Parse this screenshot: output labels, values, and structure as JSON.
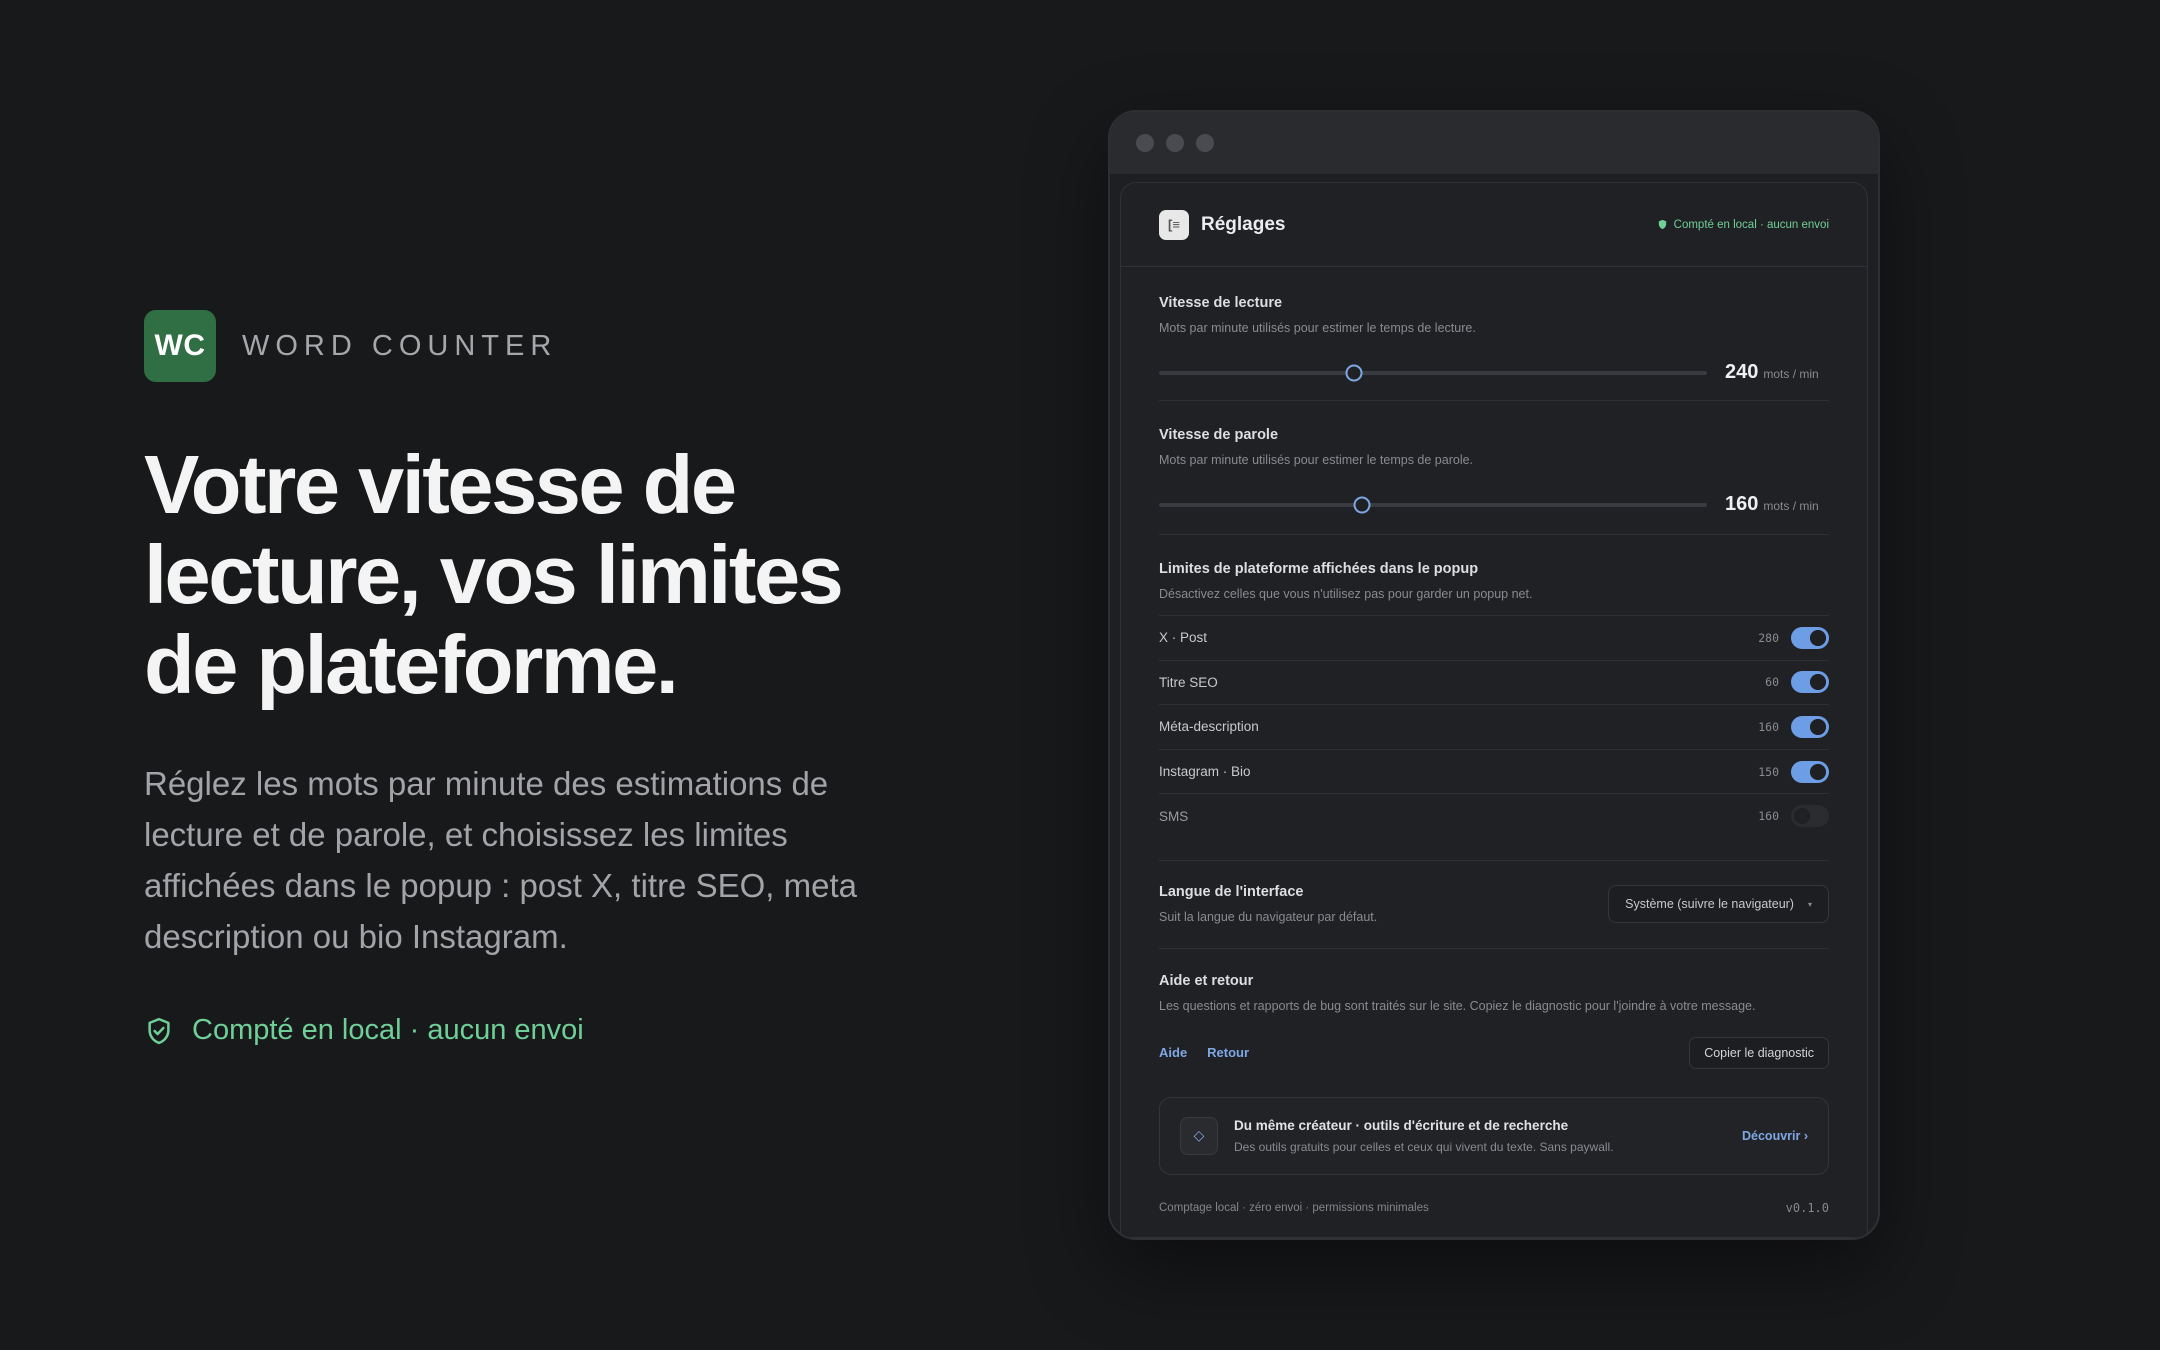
{
  "brand": {
    "logo_text": "WC",
    "name": "WORD COUNTER"
  },
  "hero": {
    "title_lines": [
      "Votre vitesse de",
      "lecture, vos limites",
      "de plateforme."
    ],
    "subtitle": "Réglez les mots par minute des estimations de lecture et de parole, et choisissez les limites affichées dans le popup : post X, titre SEO, meta description ou bio Instagram.",
    "badge": "Compté en local · aucun envoi"
  },
  "colors": {
    "accent": "#6d9de4",
    "brand": "#2f6f43",
    "success": "#6fcf97",
    "background": "#18191b"
  },
  "window": {
    "header": {
      "icon": "settings-app-icon",
      "title": "Réglages",
      "badge": "Compté en local · aucun envoi"
    },
    "reading": {
      "title": "Vitesse de lecture",
      "desc": "Mots par minute utilisés pour estimer le temps de lecture.",
      "value": "240",
      "unit": "mots / min",
      "fraction": 0.355
    },
    "speaking": {
      "title": "Vitesse de parole",
      "desc": "Mots par minute utilisés pour estimer le temps de parole.",
      "value": "160",
      "unit": "mots / min",
      "fraction": 0.37
    },
    "limits": {
      "title": "Limites de plateforme affichées dans le popup",
      "desc": "Désactivez celles que vous n'utilisez pas pour garder un popup net.",
      "items": [
        {
          "label": "X · Post",
          "limit": "280",
          "enabled": true
        },
        {
          "label": "Titre SEO",
          "limit": "60",
          "enabled": true
        },
        {
          "label": "Méta-description",
          "limit": "160",
          "enabled": true
        },
        {
          "label": "Instagram · Bio",
          "limit": "150",
          "enabled": true
        },
        {
          "label": "SMS",
          "limit": "160",
          "enabled": false
        }
      ]
    },
    "language": {
      "title": "Langue de l'interface",
      "desc": "Suit la langue du navigateur par défaut.",
      "selected": "Système (suivre le navigateur)"
    },
    "help": {
      "title": "Aide et retour",
      "desc": "Les questions et rapports de bug sont traités sur le site. Copiez le diagnostic pour l'joindre à votre message.",
      "link_help": "Aide",
      "link_feedback": "Retour",
      "copy_button": "Copier le diagnostic"
    },
    "promo": {
      "icon": "diamond-icon",
      "title": "Du même créateur · outils d'écriture et de recherche",
      "desc": "Des outils gratuits pour celles et ceux qui vivent du texte. Sans paywall.",
      "cta": "Découvrir ›"
    },
    "footer": {
      "left": "Comptage local · zéro envoi · permissions minimales",
      "version": "v0.1.0"
    }
  }
}
